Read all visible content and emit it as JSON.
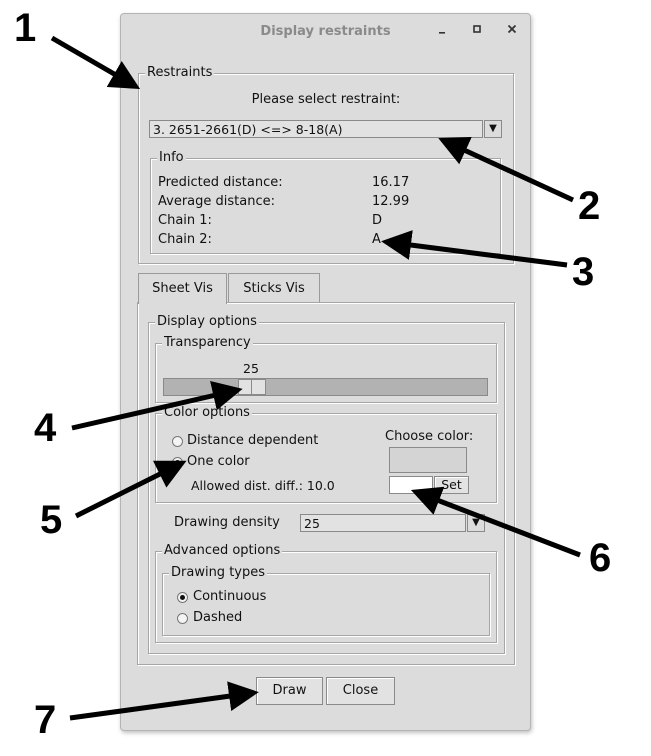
{
  "window": {
    "title": "Display restraints",
    "minimize_label": "_",
    "maximize_label": "▫",
    "close_label": "×"
  },
  "restraints": {
    "group_label": "Restraints",
    "prompt": "Please select restraint:",
    "selected": "3. 2651-2661(D) <=> 8-18(A)",
    "dropdown_icon": "▼"
  },
  "info": {
    "group_label": "Info",
    "rows": [
      {
        "label": "Predicted distance:",
        "value": "16.17"
      },
      {
        "label": "Average distance:",
        "value": "12.99"
      },
      {
        "label": "Chain 1:",
        "value": "D"
      },
      {
        "label": "Chain 2:",
        "value": "A"
      }
    ]
  },
  "tabs": [
    {
      "label": "Sheet Vis",
      "active": true
    },
    {
      "label": "Sticks Vis",
      "active": false
    }
  ],
  "display_options": {
    "group_label": "Display options",
    "transparency": {
      "group_label": "Transparency",
      "value": "25",
      "fraction": 0.25
    },
    "color_options": {
      "group_label": "Color options",
      "distance_dependent": "Distance dependent",
      "one_color": "One color",
      "selected": "One color",
      "allowed_diff": "Allowed dist. diff.: 10.0",
      "choose_color": "Choose color:",
      "set_button": "Set"
    },
    "drawing_density": {
      "label": "Drawing density",
      "value": "25"
    },
    "advanced": {
      "group_label": "Advanced options",
      "drawing_types_label": "Drawing types",
      "continuous": "Continuous",
      "dashed": "Dashed",
      "selected": "Continuous"
    }
  },
  "buttons": {
    "draw": "Draw",
    "close": "Close"
  },
  "callouts": [
    "1",
    "2",
    "3",
    "4",
    "5",
    "6",
    "7"
  ]
}
